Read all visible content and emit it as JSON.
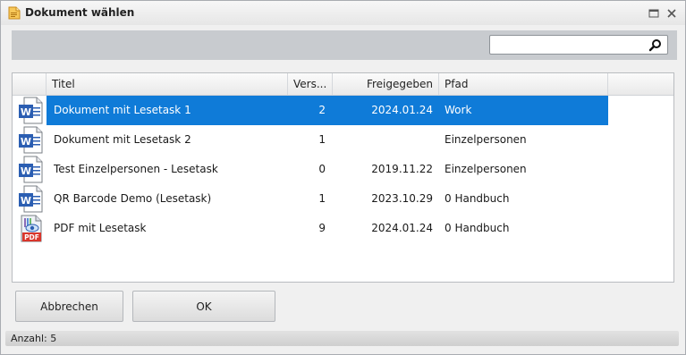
{
  "window": {
    "title": "Dokument wählen",
    "icon": "document-icon",
    "controls": [
      "maximize-icon",
      "close-icon"
    ]
  },
  "search": {
    "value": "",
    "placeholder": "",
    "button_icon": "search-icon"
  },
  "table": {
    "headers": {
      "title": "Titel",
      "version": "Vers...",
      "released": "Freigegeben",
      "path": "Pfad"
    },
    "rows": [
      {
        "icon": "word-document-icon",
        "title": "Dokument mit Lesetask 1",
        "version": "2",
        "released": "2024.01.24",
        "path": "Work",
        "selected": true
      },
      {
        "icon": "word-document-icon",
        "title": "Dokument mit Lesetask 2",
        "version": "1",
        "released": "",
        "path": "Einzelpersonen",
        "selected": false
      },
      {
        "icon": "word-document-icon",
        "title": "Test Einzelpersonen - Lesetask",
        "version": "0",
        "released": "2019.11.22",
        "path": "Einzelpersonen",
        "selected": false
      },
      {
        "icon": "word-document-icon",
        "title": "QR Barcode Demo (Lesetask)",
        "version": "1",
        "released": "2023.10.29",
        "path": "0 Handbuch",
        "selected": false
      },
      {
        "icon": "pdf-document-icon",
        "title": "PDF mit Lesetask",
        "version": "9",
        "released": "2024.01.24",
        "path": "0 Handbuch",
        "selected": false
      }
    ]
  },
  "buttons": {
    "cancel": "Abbrechen",
    "ok": "OK"
  },
  "status": {
    "count_label": "Anzahl: 5"
  },
  "colors": {
    "selection": "#0f7bd8",
    "word_blue": "#2b5eb2",
    "pdf_red": "#d9362c"
  }
}
